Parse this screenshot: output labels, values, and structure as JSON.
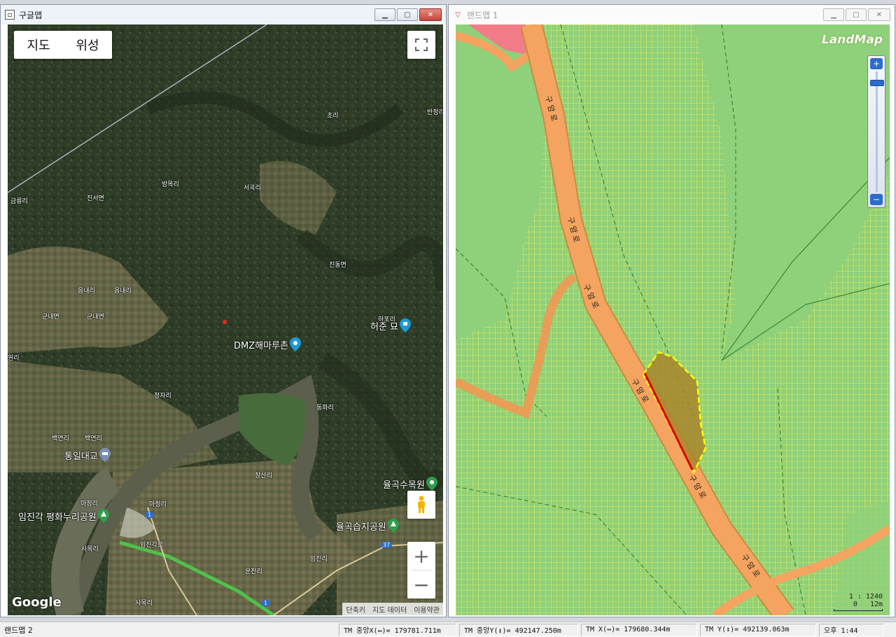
{
  "left_window": {
    "title": "구글맵",
    "map_type": {
      "map": "지도",
      "satellite": "위성"
    },
    "footer": [
      "단축키",
      "지도 데이터",
      "이용약관"
    ],
    "logo": "Google",
    "place_labels": [
      {
        "text": "초리"
      },
      {
        "text": "반정리"
      },
      {
        "text": "방목리"
      },
      {
        "text": "서곡리"
      },
      {
        "text": "금릉리"
      },
      {
        "text": "진서면"
      },
      {
        "text": "진동면"
      },
      {
        "text": "읍내리"
      },
      {
        "text": "읍내리"
      },
      {
        "text": "군내면"
      },
      {
        "text": "군내면"
      },
      {
        "text": "하포리"
      },
      {
        "text": "원리"
      },
      {
        "text": "정자리"
      },
      {
        "text": "동파리"
      },
      {
        "text": "백연리"
      },
      {
        "text": "백연리"
      },
      {
        "text": "장산리"
      },
      {
        "text": "마정리"
      },
      {
        "text": "마정리"
      },
      {
        "text": "임진리"
      },
      {
        "text": "사목리"
      },
      {
        "text": "운천리"
      },
      {
        "text": "사목리"
      },
      {
        "text": "임진각로"
      }
    ],
    "pois": [
      {
        "text": "허준 묘"
      },
      {
        "text": "DMZ해마루촌"
      },
      {
        "text": "통일대교"
      },
      {
        "text": "율곡수목원"
      },
      {
        "text": "임진각 평화누리공원"
      },
      {
        "text": "율곡습지공원"
      }
    ],
    "road_numbers": [
      "1",
      "37",
      "1"
    ]
  },
  "right_window": {
    "title": "랜드맵 1",
    "logo": "LandMap",
    "scale_text": "1 : 1240",
    "scale_bar_left": "0",
    "scale_bar_label": "12m",
    "road_labels": [
      "구 암 로",
      "구 암 로",
      "구 암 로",
      "구 암 로",
      "구 암 로",
      "구 암 로"
    ]
  },
  "status_bar": {
    "left": "랜드맵 2",
    "tm_center_x": "TM 중앙X(↔)= 179781.711m",
    "tm_center_y": "TM 중앙Y(↕)= 492147.250m",
    "tm_x": "TM X(↔)= 179680.344m",
    "tm_y": "TM Y(↕)= 492139.063m",
    "time": "오후 1:44"
  },
  "colors": {
    "satellite_dark": "#2c3a26",
    "land_green": "#8fd07a",
    "grid_yellow": "#e8ec5a",
    "road_orange": "#f4a460",
    "parcel_fill": "#a8862c"
  }
}
